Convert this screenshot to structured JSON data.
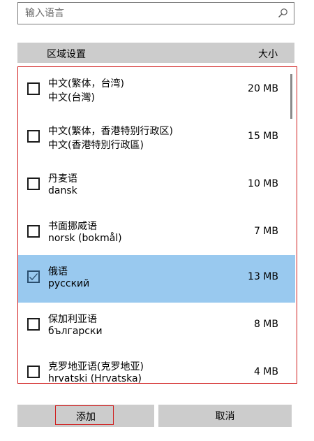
{
  "search": {
    "placeholder": "输入语言"
  },
  "header": {
    "region_label": "区域设置",
    "size_label": "大小"
  },
  "languages": [
    {
      "name": "中文(繁体，台湾)",
      "native": "中文(台灣)",
      "size": "20 MB",
      "checked": false
    },
    {
      "name": "中文(繁体，香港特别行政区)",
      "native": "中文(香港特別行政區)",
      "size": "15 MB",
      "checked": false
    },
    {
      "name": "丹麦语",
      "native": "dansk",
      "size": "10 MB",
      "checked": false
    },
    {
      "name": "书面挪威语",
      "native": "norsk (bokmål)",
      "size": "7 MB",
      "checked": false
    },
    {
      "name": "俄语",
      "native": "русский",
      "size": "13 MB",
      "checked": true
    },
    {
      "name": "保加利亚语",
      "native": "български",
      "size": "8 MB",
      "checked": false
    },
    {
      "name": "克罗地亚语(克罗地亚)",
      "native": "hrvatski (Hrvatska)",
      "size": "4 MB",
      "checked": false
    }
  ],
  "selected_language": "俄语",
  "buttons": {
    "add": "添加",
    "cancel": "取消"
  },
  "colors": {
    "selected_row": "#99c9ef",
    "header_bg": "#cccccc",
    "focus_outline": "#d01c1c"
  },
  "icons": {
    "search": "search-icon",
    "check": "checkmark-icon"
  }
}
